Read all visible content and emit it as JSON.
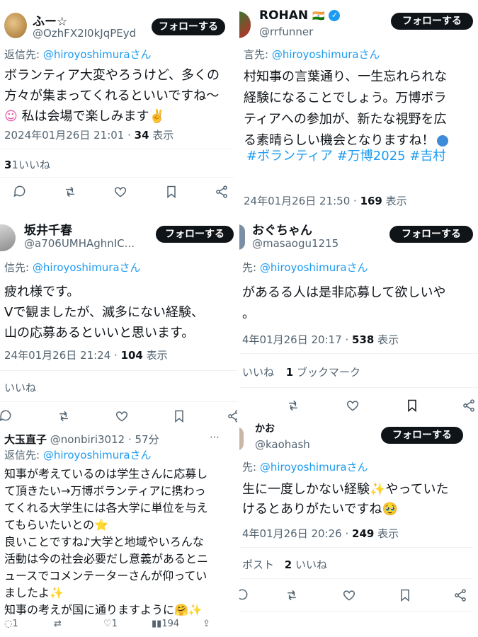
{
  "follow_label": "フォローする",
  "reply_prefix_a": "返信先:",
  "reply_prefix_b": "信先:",
  "reply_prefix_c": "言先:",
  "reply_prefix_d": "先:",
  "reply_target": "@hiroyoshimuraさん",
  "p1": {
    "name": "ふー☆",
    "handle": "@OzhFX2I0kJqPEyd",
    "lines": [
      "ボランティア大変やろうけど、多くの",
      "方々が集まってくれるといいですね～",
      "私は会場で楽しみます✌️"
    ],
    "line3_emoji": "☺",
    "date": "2024年01月26日 21:01 · ",
    "views_num": "34",
    "views_label": " 表示",
    "likes": "1いいね",
    "likes_digit": "3"
  },
  "p2": {
    "name": "ROHAN",
    "flag": "🇮🇳",
    "handle": "@rrfunner",
    "lines": [
      "村知事の言葉通り、一生忘れられな",
      "経験になることでしょう。万博ボラ",
      "ティアへの参加が、新たな視野を広",
      "る素晴らしい機会となりますね！"
    ],
    "hashtags": "#ボランティア #万博2025 #吉村",
    "date": "24年01月26日 21:50 · ",
    "views_num": "169",
    "views_label": " 表示"
  },
  "p3": {
    "name": "坂井千春",
    "handle": "@a706UMHAghnIC...",
    "lines": [
      "疲れ様です。",
      "Vで観ましたが、滅多にない経験、",
      "山の応募あるといいと思います。"
    ],
    "date": "24年01月26日 21:24 · ",
    "views_num": "104",
    "views_label": " 表示",
    "likes": "いいね"
  },
  "p4": {
    "name": "おぐちゃん",
    "handle": "@masaogu1215",
    "lines": [
      "があるる人は是非応募して欲しいや",
      "。"
    ],
    "date": "4年01月26日 20:17 · ",
    "views_num": "538",
    "views_label": " 表示",
    "likes": "いいね",
    "bookmarks_num": "1",
    "bookmarks_label": " ブックマーク"
  },
  "p5": {
    "name": "大玉直子",
    "handle": "@nonbiri3012 · 57分",
    "lines": [
      "知事が考えているのは学生さんに応募し",
      "て頂きたい→万博ボランティアに携わっ",
      "てくれる大学生には各大学に単位を与え",
      "てもらいたいとの⭐",
      "良いことですね♪大学と地域やいろんな",
      "活動は今の社会必要だし意義があるとニ",
      "ュースでコメンテーターさんが仰ってい",
      "ましたよ✨",
      "知事の考えが国に通りますように🤗✨"
    ],
    "reply_count": "1",
    "like_count": "1",
    "view_count": "194"
  },
  "p6": {
    "name": "かお",
    "handle": "@kaohash",
    "lines": [
      "生に一度しかない経験✨やっていた",
      "けるとありがたいですね🥹"
    ],
    "date": "4年01月26日 20:26 · ",
    "views_num": "249",
    "views_label": " 表示",
    "reposts": "ポスト",
    "likes_num": "2",
    "likes_label": " いいね"
  },
  "colors": {
    "accent": "#1d9bf0",
    "text": "#0f1419",
    "muted": "#536471",
    "button": "#0f1419"
  }
}
